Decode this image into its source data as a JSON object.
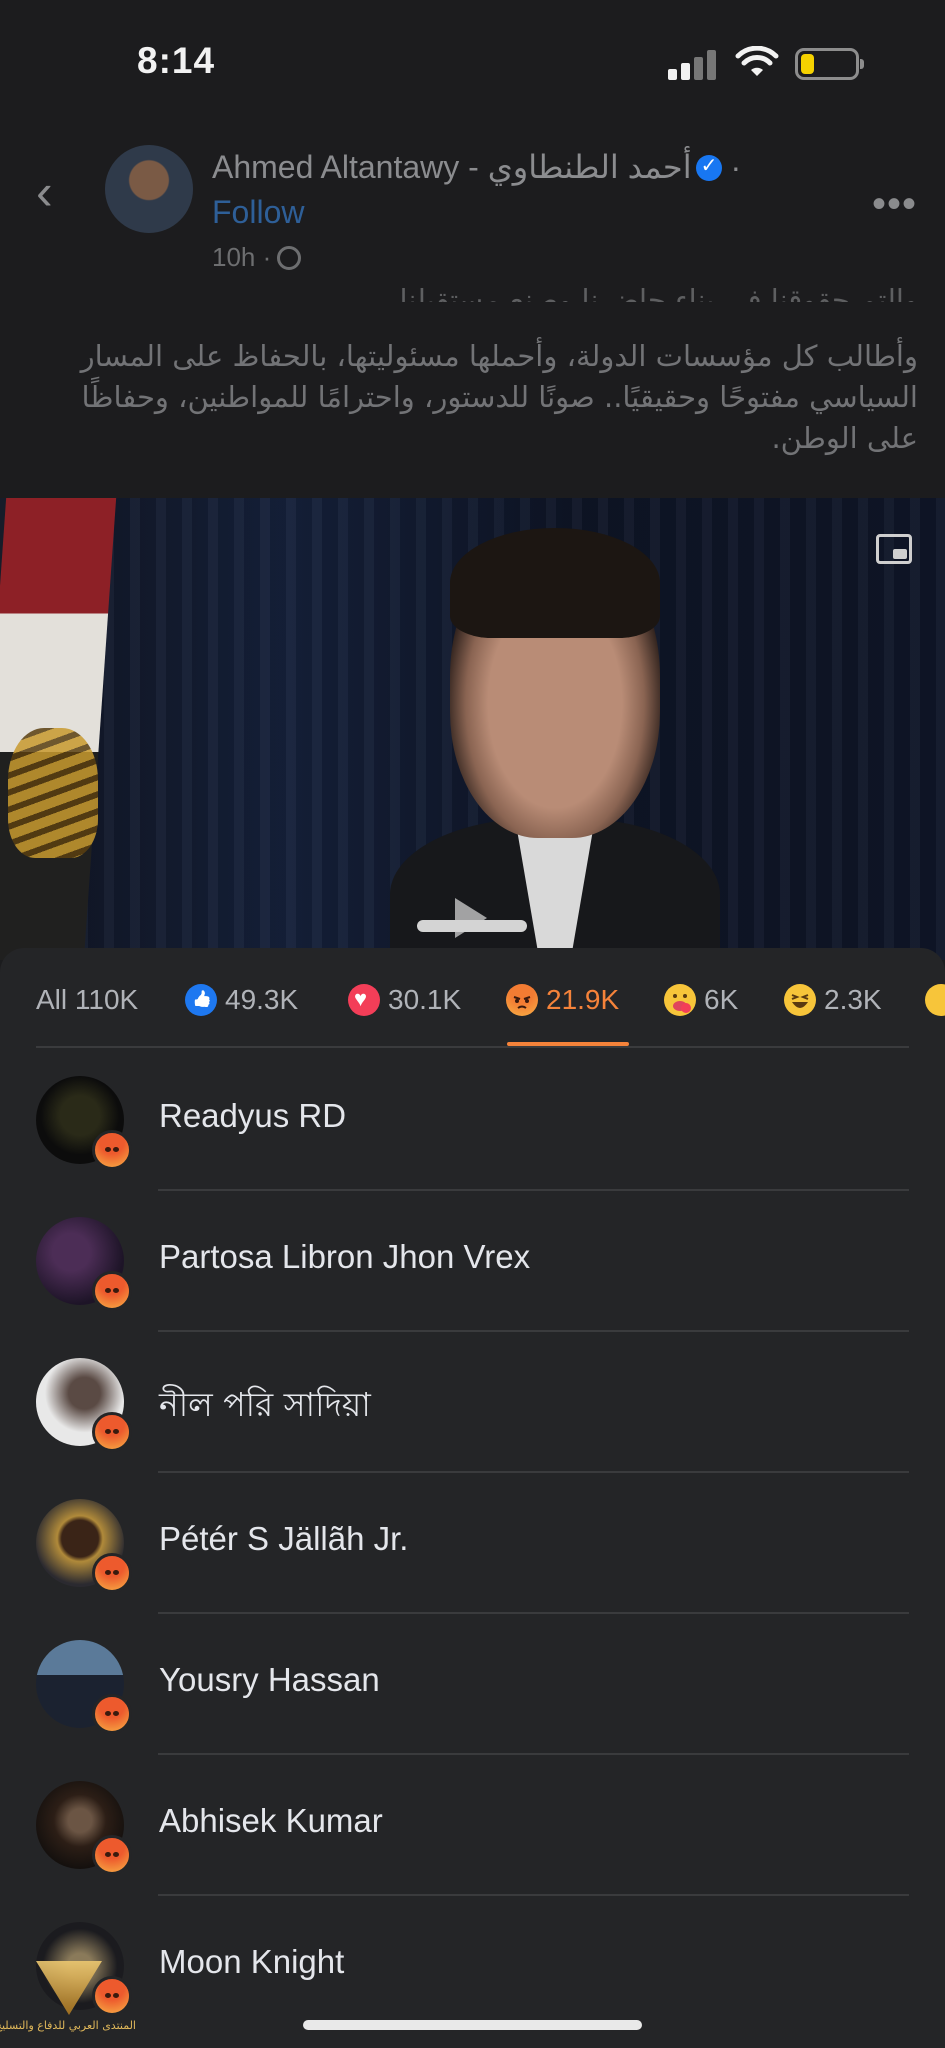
{
  "status_bar": {
    "time": "8:14",
    "battery_level": 0.25
  },
  "post": {
    "author_name": "Ahmed Altantawy - أحمد الطنطاوي",
    "author_suffix": "·",
    "follow_label": "Follow",
    "meta_time": "10h ·",
    "text_cut": "والتم حقوقنا في بناء حاضرنا وصنع مستقبلنا.",
    "text_paragraph": "وأطالب كل مؤسسات الدولة، وأحملها مسئوليتها، بالحفاظ على المسار السياسي مفتوحًا وحقيقيًا.. صونًا للدستور، واحترامًا للمواطنين، وحفاظًا على الوطن."
  },
  "reactions_tabs": [
    {
      "label": "All 110K",
      "icon": null
    },
    {
      "label": "49.3K",
      "icon": "like-icon"
    },
    {
      "label": "30.1K",
      "icon": "love-icon"
    },
    {
      "label": "21.9K",
      "icon": "angry-icon",
      "selected": true
    },
    {
      "label": "6K",
      "icon": "care-icon"
    },
    {
      "label": "2.3K",
      "icon": "haha-icon"
    },
    {
      "label": "",
      "icon": "wow-icon"
    }
  ],
  "people": [
    {
      "name": "Readyus RD",
      "reaction": "angry-icon"
    },
    {
      "name": "Partosa Libron Jhon Vrex",
      "reaction": "angry-icon"
    },
    {
      "name": "নীল পরি সাদিয়া",
      "reaction": "angry-icon"
    },
    {
      "name": "Pétér S Jällãh Jr.",
      "reaction": "angry-icon"
    },
    {
      "name": "Yousry Hassan",
      "reaction": "angry-icon"
    },
    {
      "name": "Abhisek Kumar",
      "reaction": "angry-icon"
    },
    {
      "name": "Moon Knight",
      "reaction": "angry-icon"
    }
  ],
  "watermark": {
    "text": "المنتدى العربي للدفاع والتسليح"
  },
  "colors": {
    "accent_angry": "#f5833a",
    "sheet_bg": "#242527",
    "follow": "#2e5f98"
  }
}
